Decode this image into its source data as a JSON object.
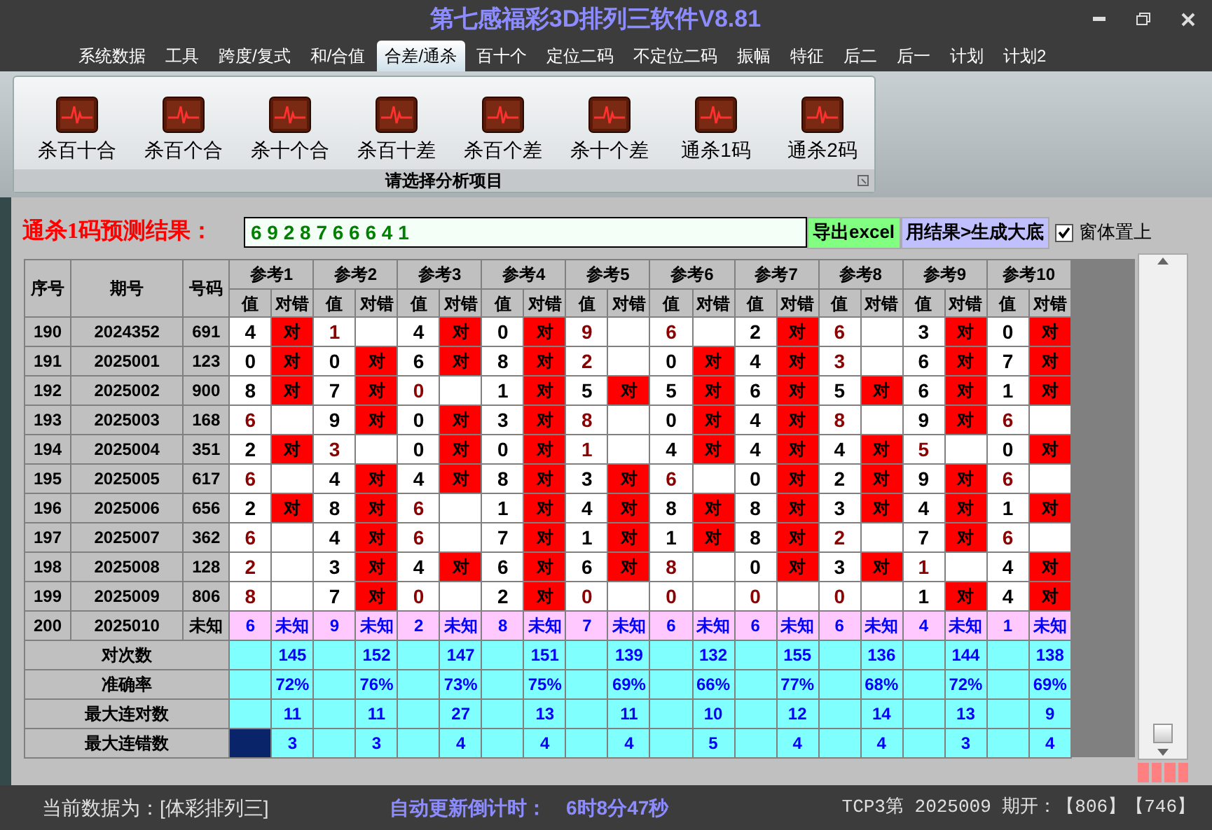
{
  "window": {
    "title": "第七感福彩3D排列三软件V8.81"
  },
  "menu": [
    {
      "label": "系统数据",
      "selected": false
    },
    {
      "label": "工具",
      "selected": false
    },
    {
      "label": "跨度/复式",
      "selected": false
    },
    {
      "label": "和/合值",
      "selected": false
    },
    {
      "label": "合差/通杀",
      "selected": true
    },
    {
      "label": "百十个",
      "selected": false
    },
    {
      "label": "定位二码",
      "selected": false
    },
    {
      "label": "不定位二码",
      "selected": false
    },
    {
      "label": "振幅",
      "selected": false
    },
    {
      "label": "特征",
      "selected": false
    },
    {
      "label": "后二",
      "selected": false
    },
    {
      "label": "后一",
      "selected": false
    },
    {
      "label": "计划",
      "selected": false
    },
    {
      "label": "计划2",
      "selected": false
    }
  ],
  "ribbon": {
    "items": [
      "杀百十合",
      "杀百个合",
      "杀十个合",
      "杀百十差",
      "杀百个差",
      "杀十个差",
      "通杀1码",
      "通杀2码"
    ],
    "caption": "请选择分析项目"
  },
  "prediction": {
    "label": "通杀1码预测结果：",
    "value": "6 9 2 8 7 6 6 6 4 1",
    "buttons": [
      {
        "label": "导出excel",
        "kind": "export"
      },
      {
        "label": "用结果>生成大底",
        "kind": "generate"
      }
    ],
    "topmost": {
      "label": "窗体置上",
      "checked": true
    }
  },
  "table": {
    "columns": [
      "序号",
      "期号",
      "号码"
    ],
    "groups": [
      {
        "label": "参考1",
        "subcolumns": [
          "值",
          "对错"
        ]
      },
      {
        "label": "参考2",
        "subcolumns": [
          "值",
          "对错"
        ]
      },
      {
        "label": "参考3",
        "subcolumns": [
          "值",
          "对错"
        ]
      },
      {
        "label": "参考4",
        "subcolumns": [
          "值",
          "对错"
        ]
      },
      {
        "label": "参考5",
        "subcolumns": [
          "值",
          "对错"
        ]
      },
      {
        "label": "参考6",
        "subcolumns": [
          "值",
          "对错"
        ]
      },
      {
        "label": "参考7",
        "subcolumns": [
          "值",
          "对错"
        ]
      },
      {
        "label": "参考8",
        "subcolumns": [
          "值",
          "对错"
        ]
      },
      {
        "label": "参考9",
        "subcolumns": [
          "值",
          "对错"
        ]
      },
      {
        "label": "参考10",
        "subcolumns": [
          "值",
          "对错"
        ]
      }
    ],
    "rows": [
      {
        "kind": "history",
        "seq": "190",
        "period": "2024352",
        "number": "691",
        "cells": [
          {
            "value": "4",
            "hit": true,
            "result": "对"
          },
          {
            "value": "1",
            "hit": false
          },
          {
            "value": "4",
            "hit": true,
            "result": "对"
          },
          {
            "value": "0",
            "hit": true,
            "result": "对"
          },
          {
            "value": "9",
            "hit": false
          },
          {
            "value": "6",
            "hit": false
          },
          {
            "value": "2",
            "hit": true,
            "result": "对"
          },
          {
            "value": "6",
            "hit": false
          },
          {
            "value": "3",
            "hit": true,
            "result": "对"
          },
          {
            "value": "0",
            "hit": true,
            "result": "对"
          }
        ]
      },
      {
        "kind": "history",
        "seq": "191",
        "period": "2025001",
        "number": "123",
        "cells": [
          {
            "value": "0",
            "hit": true,
            "result": "对"
          },
          {
            "value": "0",
            "hit": true,
            "result": "对"
          },
          {
            "value": "6",
            "hit": true,
            "result": "对"
          },
          {
            "value": "8",
            "hit": true,
            "result": "对"
          },
          {
            "value": "2",
            "hit": false
          },
          {
            "value": "0",
            "hit": true,
            "result": "对"
          },
          {
            "value": "4",
            "hit": true,
            "result": "对"
          },
          {
            "value": "3",
            "hit": false
          },
          {
            "value": "6",
            "hit": true,
            "result": "对"
          },
          {
            "value": "7",
            "hit": true,
            "result": "对"
          }
        ]
      },
      {
        "kind": "history",
        "seq": "192",
        "period": "2025002",
        "number": "900",
        "cells": [
          {
            "value": "8",
            "hit": true,
            "result": "对"
          },
          {
            "value": "7",
            "hit": true,
            "result": "对"
          },
          {
            "value": "0",
            "hit": false
          },
          {
            "value": "1",
            "hit": true,
            "result": "对"
          },
          {
            "value": "5",
            "hit": true,
            "result": "对"
          },
          {
            "value": "5",
            "hit": true,
            "result": "对"
          },
          {
            "value": "6",
            "hit": true,
            "result": "对"
          },
          {
            "value": "5",
            "hit": true,
            "result": "对"
          },
          {
            "value": "6",
            "hit": true,
            "result": "对"
          },
          {
            "value": "1",
            "hit": true,
            "result": "对"
          }
        ]
      },
      {
        "kind": "history",
        "seq": "193",
        "period": "2025003",
        "number": "168",
        "cells": [
          {
            "value": "6",
            "hit": false
          },
          {
            "value": "9",
            "hit": true,
            "result": "对"
          },
          {
            "value": "0",
            "hit": true,
            "result": "对"
          },
          {
            "value": "3",
            "hit": true,
            "result": "对"
          },
          {
            "value": "8",
            "hit": false
          },
          {
            "value": "0",
            "hit": true,
            "result": "对"
          },
          {
            "value": "4",
            "hit": true,
            "result": "对"
          },
          {
            "value": "8",
            "hit": false
          },
          {
            "value": "9",
            "hit": true,
            "result": "对"
          },
          {
            "value": "6",
            "hit": false
          }
        ]
      },
      {
        "kind": "history",
        "seq": "194",
        "period": "2025004",
        "number": "351",
        "cells": [
          {
            "value": "2",
            "hit": true,
            "result": "对"
          },
          {
            "value": "3",
            "hit": false
          },
          {
            "value": "0",
            "hit": true,
            "result": "对"
          },
          {
            "value": "0",
            "hit": true,
            "result": "对"
          },
          {
            "value": "1",
            "hit": false
          },
          {
            "value": "4",
            "hit": true,
            "result": "对"
          },
          {
            "value": "4",
            "hit": true,
            "result": "对"
          },
          {
            "value": "4",
            "hit": true,
            "result": "对"
          },
          {
            "value": "5",
            "hit": false
          },
          {
            "value": "0",
            "hit": true,
            "result": "对"
          }
        ]
      },
      {
        "kind": "history",
        "seq": "195",
        "period": "2025005",
        "number": "617",
        "cells": [
          {
            "value": "6",
            "hit": false
          },
          {
            "value": "4",
            "hit": true,
            "result": "对"
          },
          {
            "value": "4",
            "hit": true,
            "result": "对"
          },
          {
            "value": "8",
            "hit": true,
            "result": "对"
          },
          {
            "value": "3",
            "hit": true,
            "result": "对"
          },
          {
            "value": "6",
            "hit": false
          },
          {
            "value": "0",
            "hit": true,
            "result": "对"
          },
          {
            "value": "2",
            "hit": true,
            "result": "对"
          },
          {
            "value": "9",
            "hit": true,
            "result": "对"
          },
          {
            "value": "6",
            "hit": false
          }
        ]
      },
      {
        "kind": "history",
        "seq": "196",
        "period": "2025006",
        "number": "656",
        "cells": [
          {
            "value": "2",
            "hit": true,
            "result": "对"
          },
          {
            "value": "8",
            "hit": true,
            "result": "对"
          },
          {
            "value": "6",
            "hit": false
          },
          {
            "value": "1",
            "hit": true,
            "result": "对"
          },
          {
            "value": "4",
            "hit": true,
            "result": "对"
          },
          {
            "value": "8",
            "hit": true,
            "result": "对"
          },
          {
            "value": "8",
            "hit": true,
            "result": "对"
          },
          {
            "value": "3",
            "hit": true,
            "result": "对"
          },
          {
            "value": "4",
            "hit": true,
            "result": "对"
          },
          {
            "value": "1",
            "hit": true,
            "result": "对"
          }
        ]
      },
      {
        "kind": "history",
        "seq": "197",
        "period": "2025007",
        "number": "362",
        "cells": [
          {
            "value": "6",
            "hit": false
          },
          {
            "value": "4",
            "hit": true,
            "result": "对"
          },
          {
            "value": "6",
            "hit": false
          },
          {
            "value": "7",
            "hit": true,
            "result": "对"
          },
          {
            "value": "1",
            "hit": true,
            "result": "对"
          },
          {
            "value": "1",
            "hit": true,
            "result": "对"
          },
          {
            "value": "8",
            "hit": true,
            "result": "对"
          },
          {
            "value": "2",
            "hit": false
          },
          {
            "value": "7",
            "hit": true,
            "result": "对"
          },
          {
            "value": "6",
            "hit": false
          }
        ]
      },
      {
        "kind": "history",
        "seq": "198",
        "period": "2025008",
        "number": "128",
        "cells": [
          {
            "value": "2",
            "hit": false
          },
          {
            "value": "3",
            "hit": true,
            "result": "对"
          },
          {
            "value": "4",
            "hit": true,
            "result": "对"
          },
          {
            "value": "6",
            "hit": true,
            "result": "对"
          },
          {
            "value": "6",
            "hit": true,
            "result": "对"
          },
          {
            "value": "8",
            "hit": false
          },
          {
            "value": "0",
            "hit": true,
            "result": "对"
          },
          {
            "value": "3",
            "hit": true,
            "result": "对"
          },
          {
            "value": "1",
            "hit": false
          },
          {
            "value": "4",
            "hit": true,
            "result": "对"
          }
        ]
      },
      {
        "kind": "history",
        "seq": "199",
        "period": "2025009",
        "number": "806",
        "cells": [
          {
            "value": "8",
            "hit": false
          },
          {
            "value": "7",
            "hit": true,
            "result": "对"
          },
          {
            "value": "0",
            "hit": false
          },
          {
            "value": "2",
            "hit": true,
            "result": "对"
          },
          {
            "value": "0",
            "hit": false
          },
          {
            "value": "0",
            "hit": false
          },
          {
            "value": "0",
            "hit": false
          },
          {
            "value": "0",
            "hit": false
          },
          {
            "value": "1",
            "hit": true,
            "result": "对"
          },
          {
            "value": "4",
            "hit": true,
            "result": "对"
          }
        ]
      },
      {
        "kind": "pending",
        "seq": "200",
        "period": "2025010",
        "number": "未知",
        "cells": [
          {
            "value": "6",
            "result": "未知"
          },
          {
            "value": "9",
            "result": "未知"
          },
          {
            "value": "2",
            "result": "未知"
          },
          {
            "value": "8",
            "result": "未知"
          },
          {
            "value": "7",
            "result": "未知"
          },
          {
            "value": "6",
            "result": "未知"
          },
          {
            "value": "6",
            "result": "未知"
          },
          {
            "value": "6",
            "result": "未知"
          },
          {
            "value": "4",
            "result": "未知"
          },
          {
            "value": "1",
            "result": "未知"
          }
        ]
      }
    ],
    "stats": [
      {
        "label": "对次数",
        "selected": false,
        "values": [
          "145",
          "152",
          "147",
          "151",
          "139",
          "132",
          "155",
          "136",
          "144",
          "138"
        ]
      },
      {
        "label": "准确率",
        "selected": false,
        "values": [
          "72%",
          "76%",
          "73%",
          "75%",
          "69%",
          "66%",
          "77%",
          "68%",
          "72%",
          "69%"
        ]
      },
      {
        "label": "最大连对数",
        "selected": false,
        "values": [
          "11",
          "11",
          "27",
          "13",
          "11",
          "10",
          "12",
          "14",
          "13",
          "9"
        ]
      },
      {
        "label": "最大连错数",
        "selected": true,
        "values": [
          "3",
          "3",
          "4",
          "4",
          "4",
          "5",
          "4",
          "4",
          "3",
          "4"
        ]
      }
    ]
  },
  "status_bar": {
    "data_source": "当前数据为：[体彩排列三]",
    "countdown_label": "自动更新倒计时：",
    "countdown": "6时8分47秒",
    "latest": "TCP3第 2025009 期开：【806】【746】"
  }
}
